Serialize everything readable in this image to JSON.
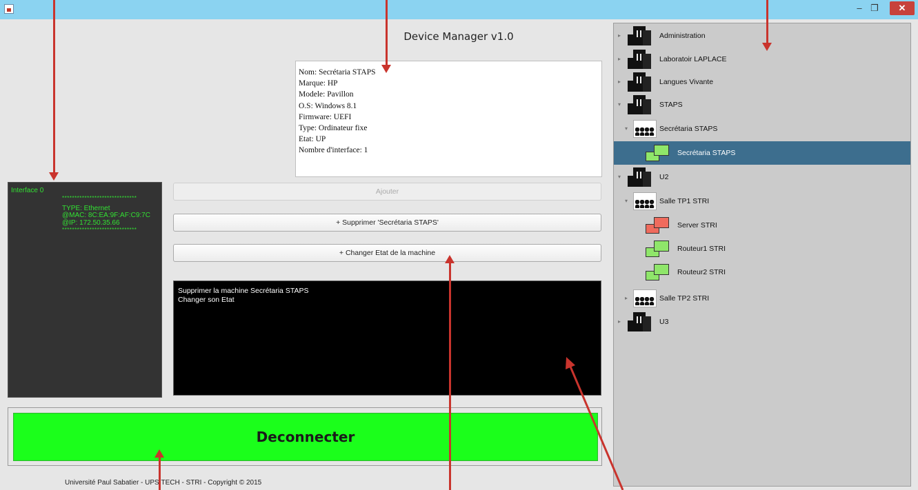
{
  "window": {
    "min": "–",
    "max": "❐",
    "close": "✕"
  },
  "app_title": "Device Manager v1.0",
  "device_info": [
    "Nom: Secrétaria STAPS",
    "Marque: HP",
    "Modele: Pavillon",
    "O.S: Windows 8.1",
    "Firmware: UEFI",
    "Type: Ordinateur fixe",
    "Etat: UP",
    "Nombre d'interface: 1"
  ],
  "interface": {
    "title": "Interface 0",
    "stars": "******************************",
    "type": "TYPE: Ethernet",
    "mac": "@MAC: 8C:EA:9F:AF:C9:7C",
    "ip": "@IP: 172.50.35.66"
  },
  "buttons": {
    "add": "Ajouter",
    "delete": "+ Supprimer 'Secrétaria STAPS'",
    "change_state": "+ Changer Etat de la machine",
    "disconnect": "Deconnecter"
  },
  "console_lines": [
    "Supprimer la machine Secrétaria STAPS",
    "Changer son Etat"
  ],
  "footer": "Université Paul Sabatier - UPSITECH - STRI - Copyright © 2015",
  "tree": [
    {
      "label": "Administration",
      "icon": "building-icon",
      "arrow": "▸"
    },
    {
      "label": "Laboratoir LAPLACE",
      "icon": "building-icon",
      "arrow": "▸"
    },
    {
      "label": "Langues Vivante",
      "icon": "building-icon",
      "arrow": "▸"
    },
    {
      "label": "STAPS",
      "icon": "building-icon",
      "arrow": "▾"
    },
    {
      "label": "Secrétaria STAPS",
      "icon": "room-icon",
      "arrow": "▾"
    },
    {
      "label": "Secrétaria STAPS",
      "icon": "computer-icon",
      "arrow": "",
      "selected": true
    },
    {
      "label": "U2",
      "icon": "building-icon",
      "arrow": "▾"
    },
    {
      "label": "Salle TP1 STRI",
      "icon": "room-icon",
      "arrow": "▾"
    },
    {
      "label": "Server STRI",
      "icon": "computer-down-icon",
      "arrow": ""
    },
    {
      "label": "Routeur1 STRI",
      "icon": "computer-icon",
      "arrow": ""
    },
    {
      "label": "Routeur2 STRI",
      "icon": "computer-icon",
      "arrow": ""
    },
    {
      "label": "Salle TP2 STRI",
      "icon": "room-icon",
      "arrow": "▸"
    },
    {
      "label": "U3",
      "icon": "building-icon",
      "arrow": "▸"
    }
  ]
}
